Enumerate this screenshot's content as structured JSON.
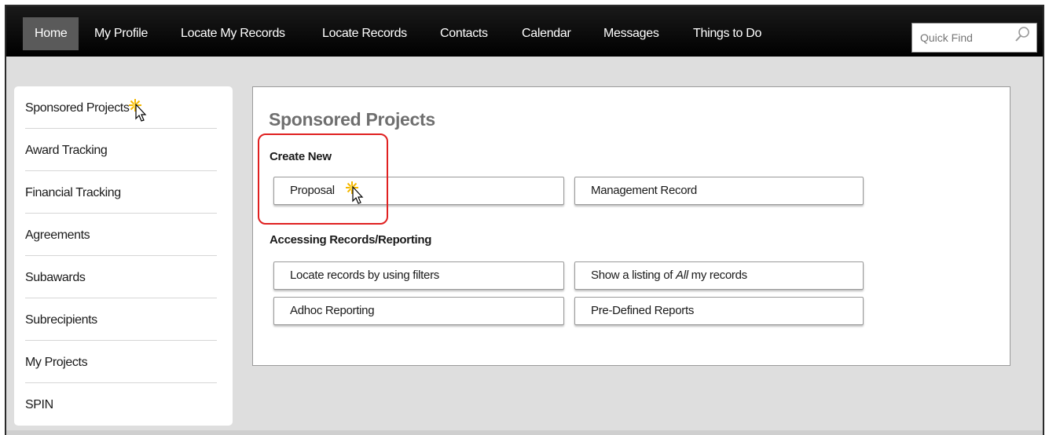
{
  "nav": {
    "items": [
      "Home",
      "My Profile",
      "Locate My Records",
      "Locate Records",
      "Contacts",
      "Calendar",
      "Messages",
      "Things to Do"
    ],
    "active": "Home",
    "quick_find_placeholder": "Quick Find"
  },
  "sidebar": {
    "items": [
      "Sponsored Projects",
      "Award Tracking",
      "Financial Tracking",
      "Agreements",
      "Subawards",
      "Subrecipients",
      "My Projects",
      "SPIN"
    ]
  },
  "main": {
    "title": "Sponsored Projects",
    "create_new": {
      "label": "Create New",
      "buttons": [
        "Proposal",
        "Management Record"
      ]
    },
    "accessing": {
      "label": "Accessing Records/Reporting",
      "buttons": [
        "Locate records by using filters",
        "Adhoc Reporting",
        "Pre-Defined Reports"
      ],
      "listing_button": {
        "before": "Show a listing of ",
        "emph": "All",
        "after": " my records"
      }
    }
  },
  "colors": {
    "topbar": "#000000",
    "active_tab": "#5a5a5a",
    "highlight": "#e02020",
    "background": "#dedede",
    "title_gray": "#6f6f6f",
    "sparkle": "#f5b800"
  },
  "icons": [
    "search-icon",
    "sparkle-cursor-icon"
  ]
}
